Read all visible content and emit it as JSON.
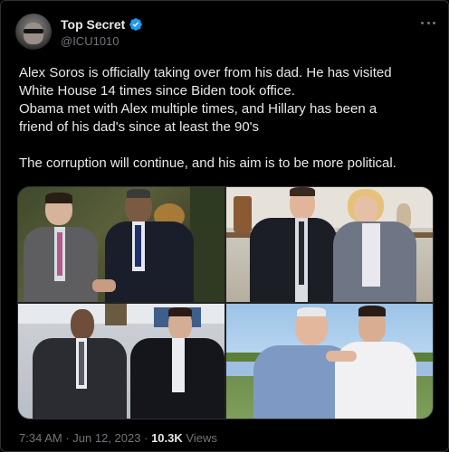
{
  "tweet": {
    "author_name": "Top Secret",
    "author_handle": "@ICU1010",
    "paragraph_1": [
      "Alex Soros is officially taking over from his dad. He has visited",
      "White House 14 times since Biden took office.",
      "Obama met with Alex multiple times, and Hillary has been a",
      "friend of his dad's since at least the 90's"
    ],
    "paragraph_2": "The corruption will continue, and his aim is to be more political.",
    "time": "7:34 AM",
    "date": "Jun 12, 2023",
    "separator": "·",
    "views_count": "10.3K",
    "views_label": "Views"
  },
  "icons": {
    "verified": "verified-badge-icon",
    "more": "more-options-icon"
  },
  "colors": {
    "background": "#000000",
    "text": "#e7e9ea",
    "secondary": "#71767b",
    "verified": "#1d9bf0",
    "border": "#2f3336"
  }
}
